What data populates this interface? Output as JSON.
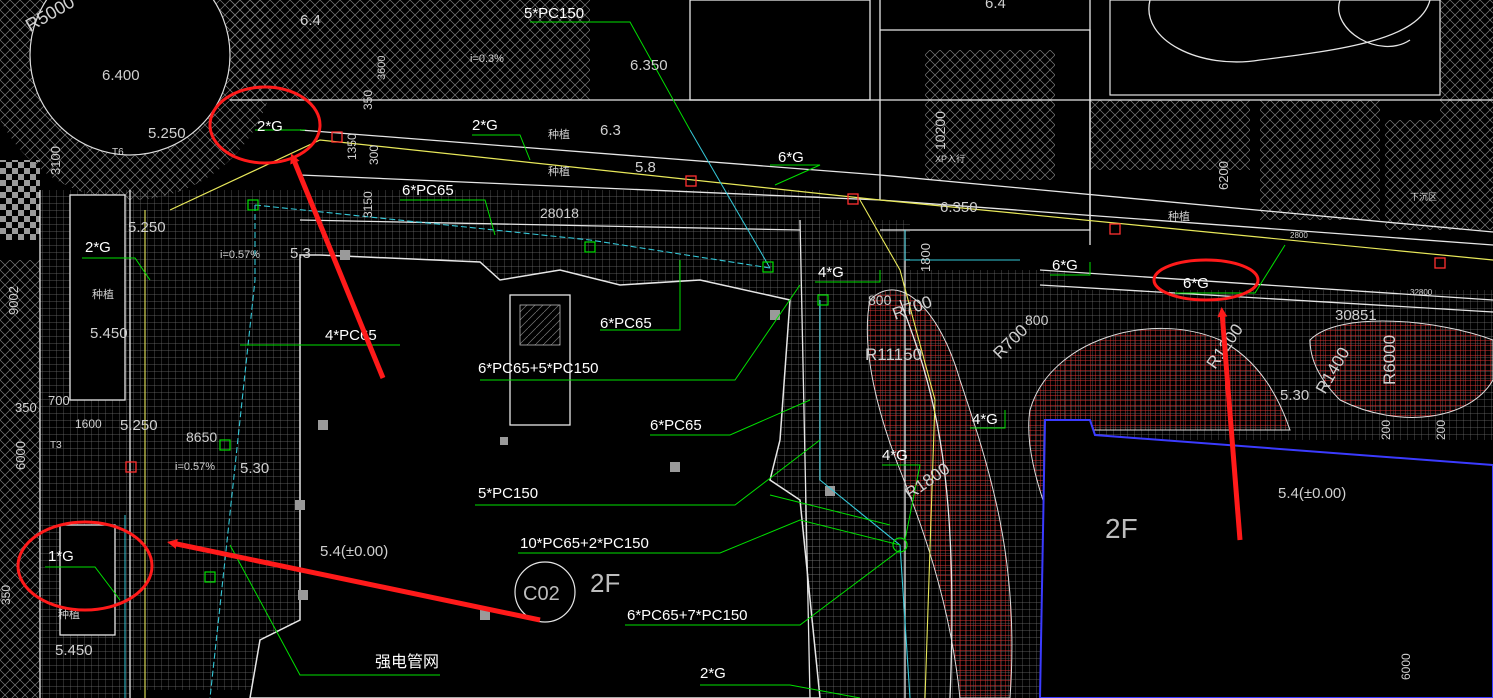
{
  "colors": {
    "background": "#000000",
    "structure": "#e6e6e6",
    "hatch": "#8a8a8a",
    "leader": "#00e000",
    "cable_cyan": "#35c8d8",
    "cable_yellow": "#e8e85a",
    "annotation_red": "#ff1a1a",
    "red_paving": "#c22a2a",
    "blue_edge": "#3b3bff",
    "label_white": "#ffffff"
  },
  "cable_labels": [
    "5*PC150",
    "2*G",
    "2*G",
    "6*PC65",
    "6*G",
    "2*G",
    "6*PC65",
    "4*G",
    "6*G",
    "6*G",
    "4*PC65",
    "6*PC65+5*PC150",
    "6*PC65",
    "4*G",
    "5*PC150",
    "4*G",
    "10*PC65+2*PC150",
    "6*PC65+7*PC150",
    "1*G",
    "强电管网",
    "2*G"
  ],
  "plants": [
    "种植",
    "种植",
    "种植",
    "种植",
    "种植"
  ],
  "elevations": [
    "6.400",
    "5.250",
    "6.350",
    "6.3",
    "5.8",
    "6.350",
    "5.250",
    "5.3",
    "5.450",
    "5.250",
    "5.30",
    "5.4(±0.00)",
    "5.450",
    "5.30",
    "5.4(±0.00)"
  ],
  "slopes": [
    "i=0.3%",
    "i=0.57%",
    "i=0.57%"
  ],
  "radii": [
    "R5000",
    "R700",
    "R11150",
    "R700",
    "R1800",
    "R1200",
    "R1400",
    "R6000"
  ],
  "dimensions": [
    "6.4",
    "6.4",
    "3600",
    "350",
    "1350",
    "300",
    "3150",
    "3100",
    "28018",
    "9002",
    "8650",
    "1600",
    "700",
    "350",
    "6000",
    "800",
    "800",
    "1800",
    "30851",
    "10200",
    "6200",
    "200",
    "200",
    "350",
    "2800",
    "32800",
    "6000"
  ],
  "room_labels": [
    "2F",
    "2F",
    "C02",
    "T6",
    "T3"
  ],
  "small_texts": [
    "XP入行",
    "下沉区"
  ]
}
